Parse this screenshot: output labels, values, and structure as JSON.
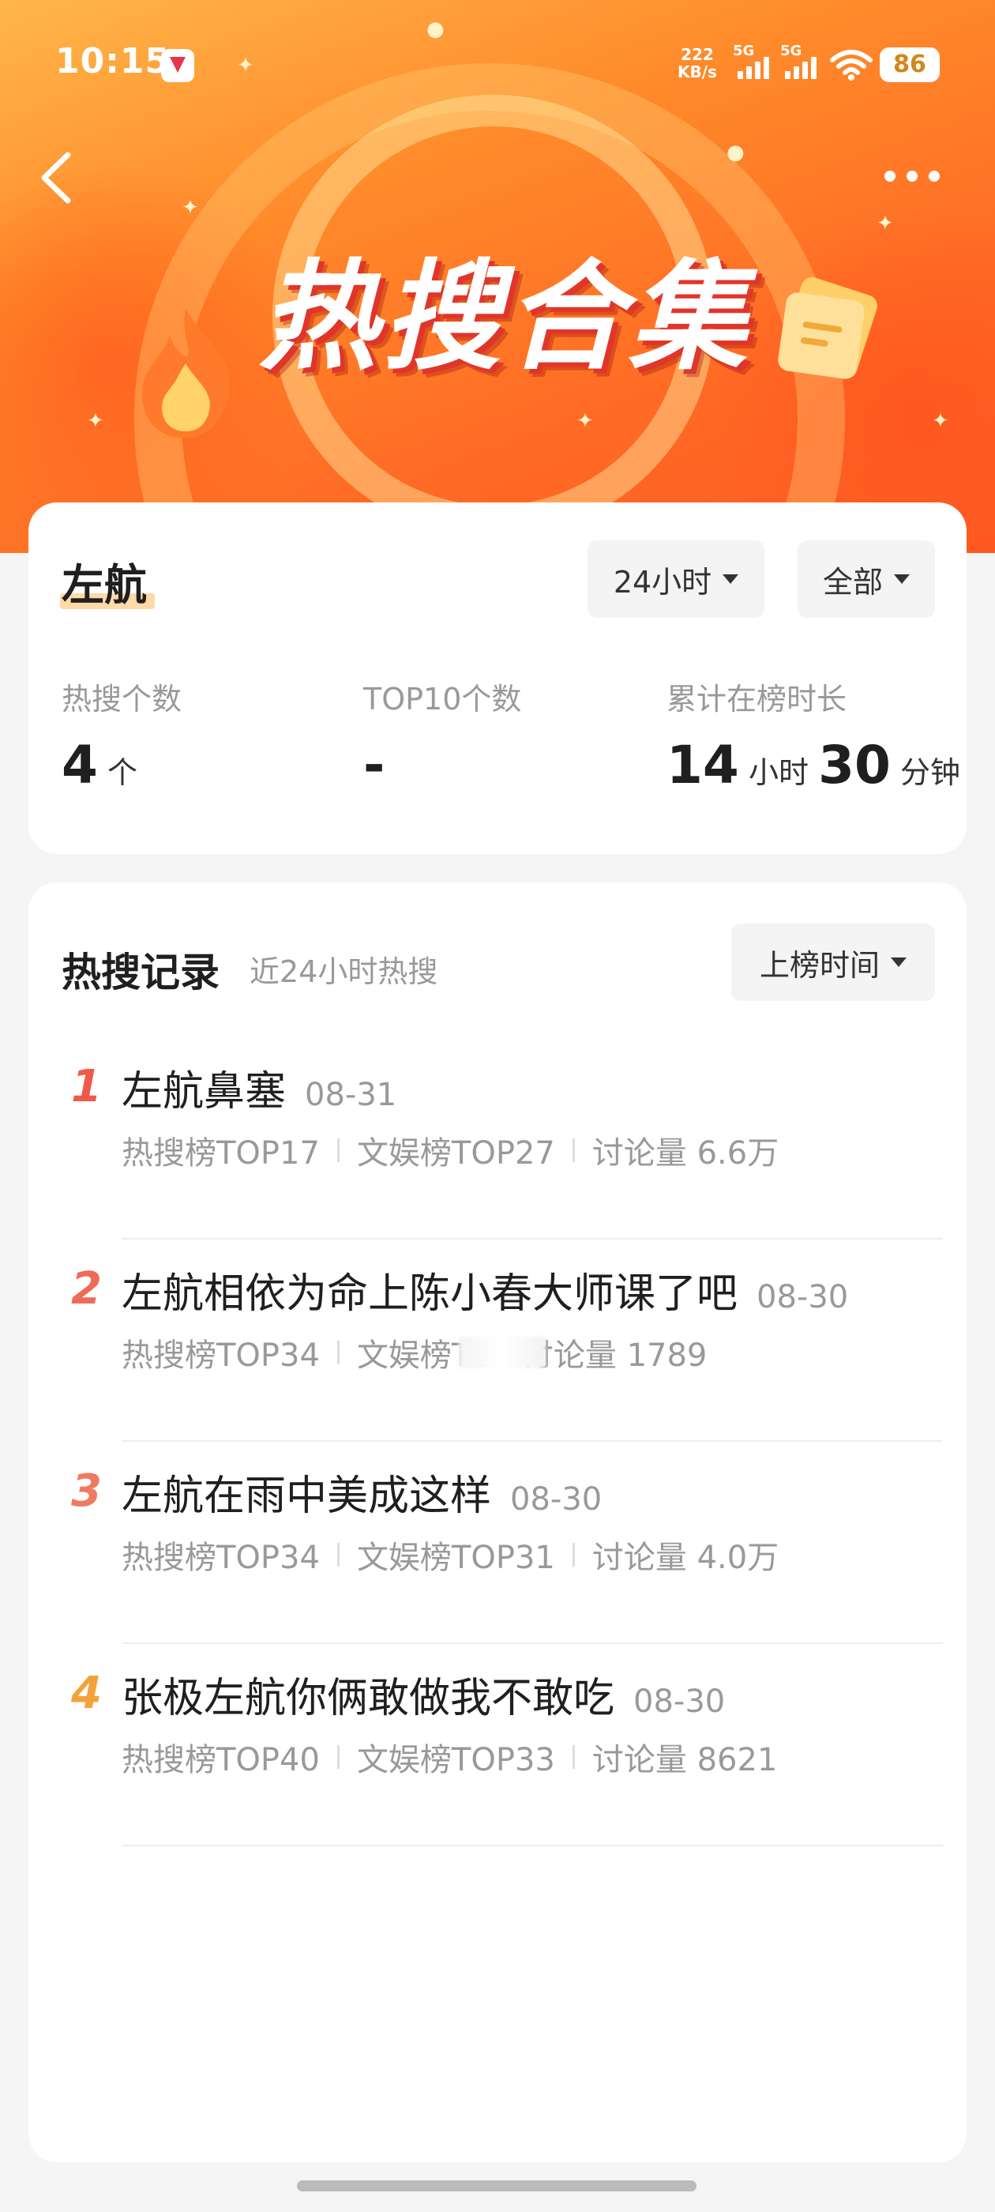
{
  "status_bar": {
    "time": "10:15",
    "net_speed_value": "222",
    "net_speed_unit": "KB/s",
    "sim1_tag": "5G",
    "sim2_tag": "5G",
    "battery": "86"
  },
  "banner": {
    "title": "热搜合集"
  },
  "summary": {
    "name": "左航",
    "time_filter": "24小时",
    "type_filter": "全部",
    "stats": [
      {
        "label": "热搜个数",
        "value": "4",
        "unit": "个"
      },
      {
        "label": "TOP10个数",
        "value": "-",
        "unit": ""
      },
      {
        "label": "累计在榜时长",
        "hours": "14",
        "hours_unit": "小时",
        "minutes": "30",
        "minutes_unit": "分钟"
      }
    ]
  },
  "records": {
    "title": "热搜记录",
    "subtitle": "近24小时热搜",
    "sort_label": "上榜时间",
    "items": [
      {
        "rank": "1",
        "headline": "左航鼻塞",
        "date": "08-31",
        "hot": "热搜榜TOP17",
        "ent": "文娱榜TOP27",
        "discuss": "讨论量 6.6万",
        "rank_color": "#f05a4a"
      },
      {
        "rank": "2",
        "headline": "左航相依为命上陈小春大师课了吧",
        "date": "08-30",
        "hot": "热搜榜TOP34",
        "ent": "文娱榜TOF",
        "discuss": "讨论量 1789",
        "rank_color": "#f06a55"
      },
      {
        "rank": "3",
        "headline": "左航在雨中美成这样",
        "date": "08-30",
        "hot": "热搜榜TOP34",
        "ent": "文娱榜TOP31",
        "discuss": "讨论量 4.0万",
        "rank_color": "#f07a60"
      },
      {
        "rank": "4",
        "headline": "张极左航你俩敢做我不敢吃",
        "date": "08-30",
        "hot": "热搜榜TOP40",
        "ent": "文娱榜TOP33",
        "discuss": "讨论量 8621",
        "rank_color": "#f3a23a"
      }
    ]
  },
  "icons": {
    "back": "chevron-left-icon",
    "more": "more-dots-icon",
    "flame": "flame-icon",
    "folder": "folder-icon"
  }
}
